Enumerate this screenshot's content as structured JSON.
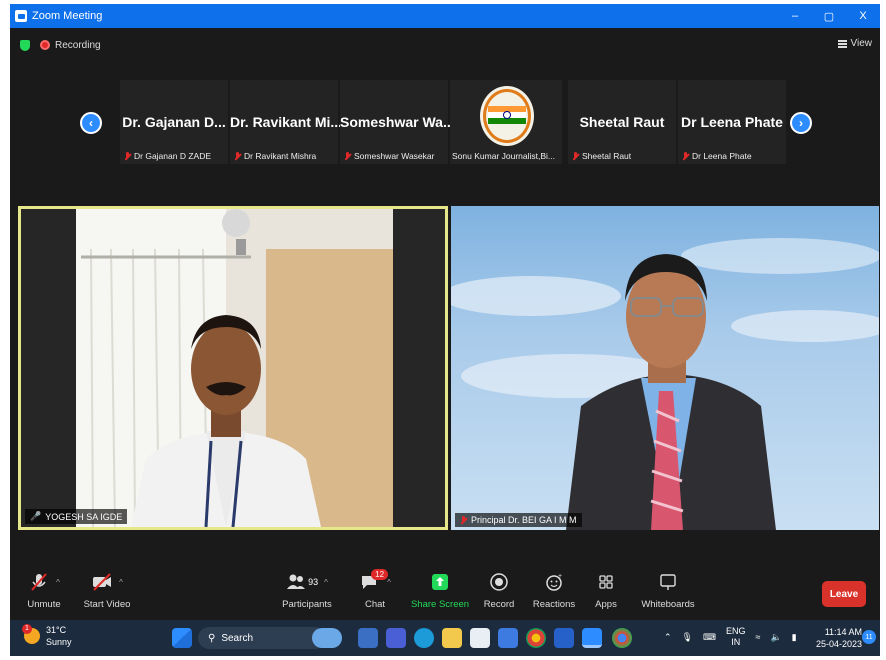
{
  "window": {
    "title": "Zoom Meeting",
    "controls": {
      "minimize": "–",
      "restore": "▢",
      "close": "X"
    }
  },
  "status": {
    "recording_label": "Recording",
    "view_label": "View"
  },
  "strip": {
    "participants": [
      {
        "display": "Dr. Gajanan D...",
        "name": "Dr Gajanan D ZADE",
        "muted": true
      },
      {
        "display": "Dr. Ravikant Mi...",
        "name": "Dr Ravikant Mishra",
        "muted": true
      },
      {
        "display": "Someshwar Wa...",
        "name": "Someshwar Wasekar",
        "muted": true
      },
      {
        "display": "",
        "name": "Sonu Kumar Journalist,Bi...",
        "muted": false,
        "logo": true
      },
      {
        "display": "Sheetal Raut",
        "name": "Sheetal Raut",
        "muted": true
      },
      {
        "display": "Dr Leena Phate",
        "name": "Dr Leena Phate",
        "muted": true
      }
    ]
  },
  "videos": {
    "left_name": "YOGESH SA IGDE",
    "right_name": "Principal Dr. BEI GA I M M"
  },
  "toolbar": {
    "unmute": "Unmute",
    "start_video": "Start Video",
    "participants": "Participants",
    "participants_count": "93",
    "chat": "Chat",
    "chat_badge": "12",
    "share_screen": "Share Screen",
    "record": "Record",
    "reactions": "Reactions",
    "apps": "Apps",
    "whiteboards": "Whiteboards",
    "leave": "Leave"
  },
  "taskbar": {
    "temperature": "31°C",
    "weather": "Sunny",
    "weather_badge": "1",
    "search_label": "Search",
    "lang_top": "ENG",
    "lang_bottom": "IN",
    "time": "11:14 AM",
    "date": "25-04-2023",
    "notif_count": "11"
  },
  "colors": {
    "zoom_blue": "#0e71eb",
    "leave_red": "#d9322a",
    "share_green": "#23d959",
    "active_speaker": "#e6e68a"
  }
}
